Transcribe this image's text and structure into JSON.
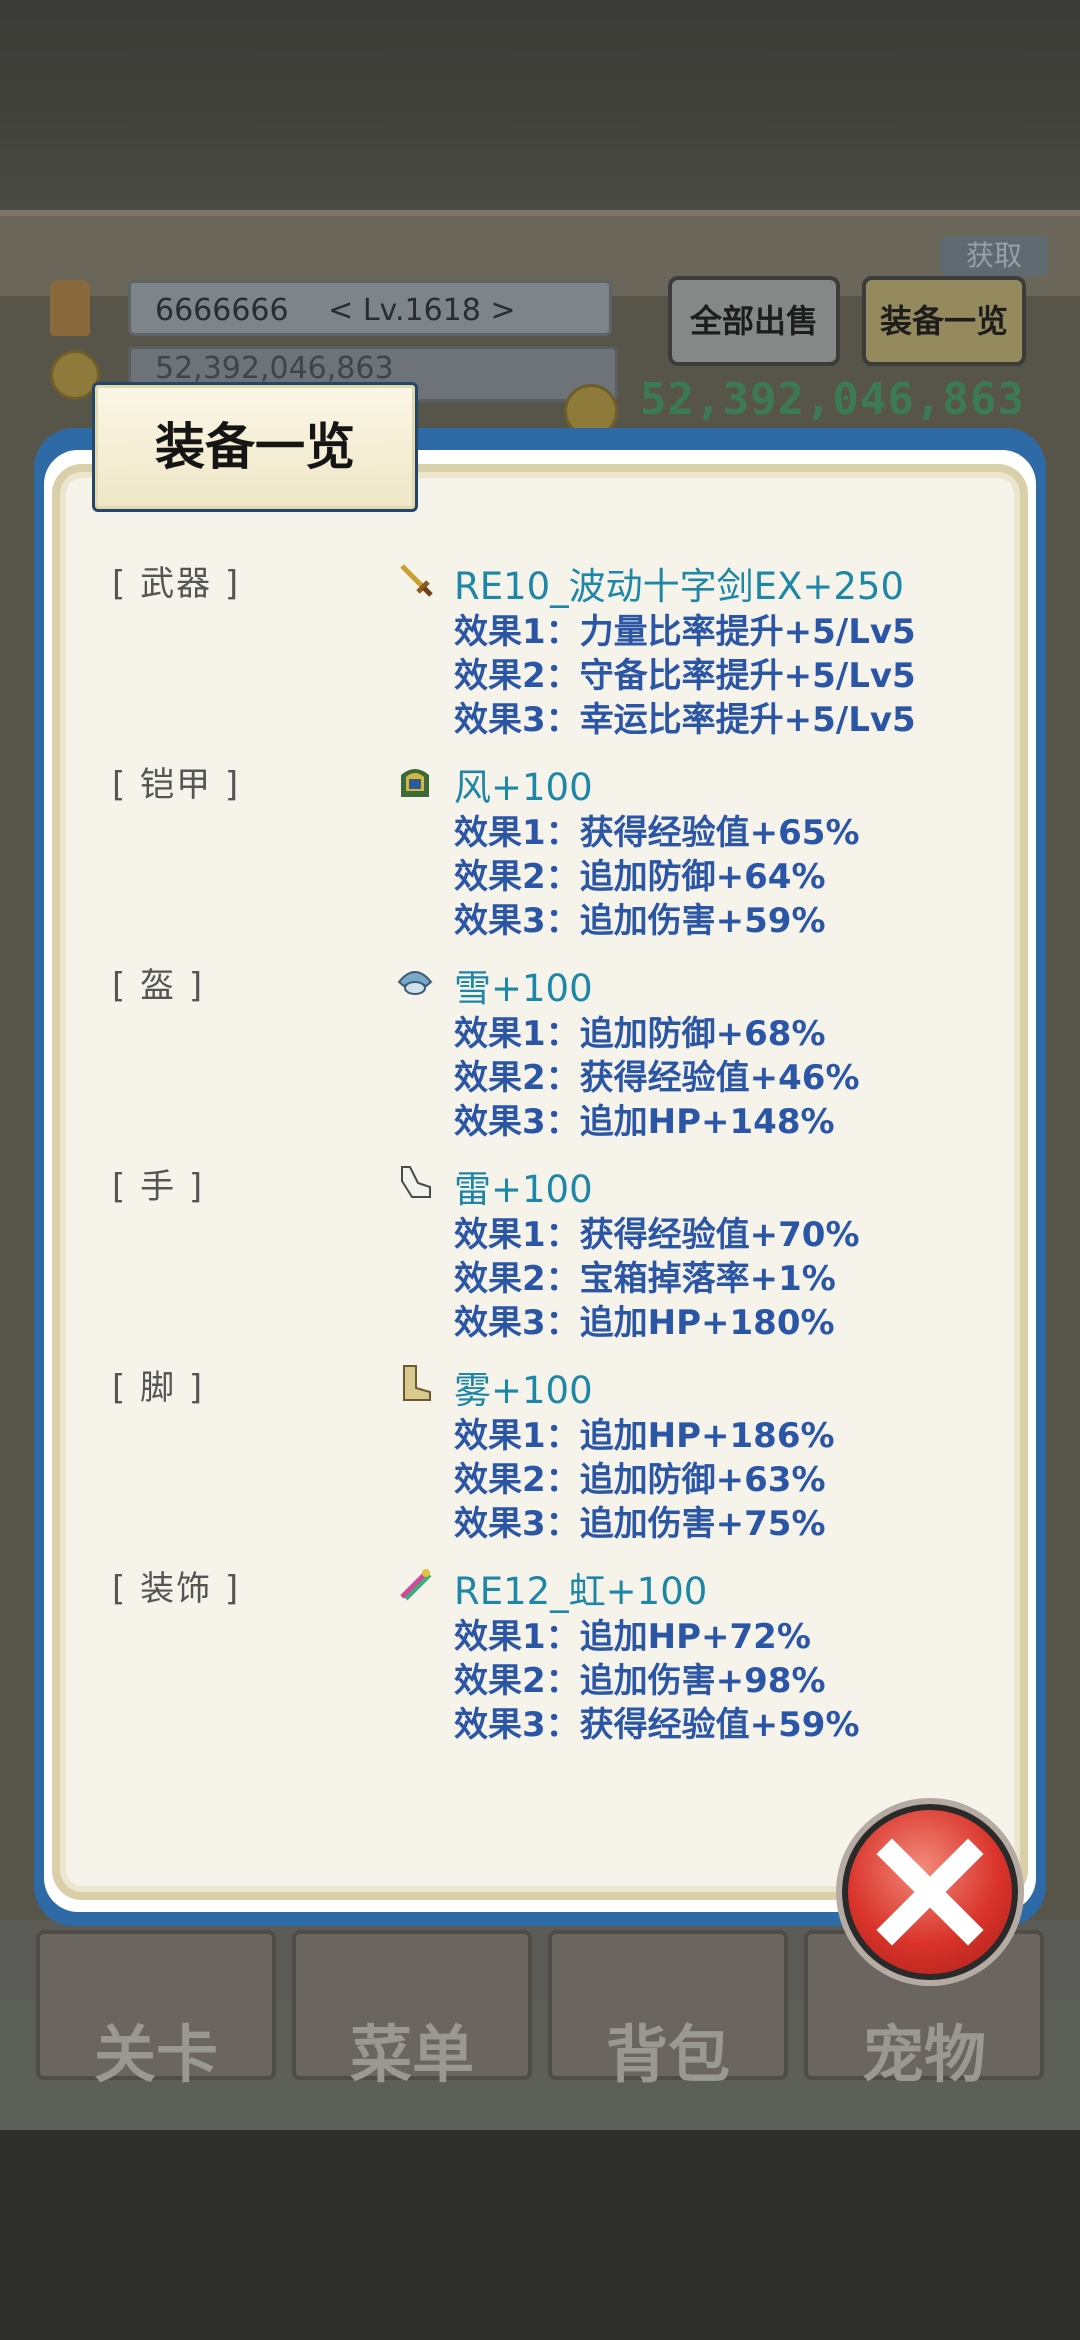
{
  "header": {
    "player_name": "6666666",
    "player_level": "< Lv.1618 >",
    "gold_amount_hidden": "52,392,046,863",
    "gold_amount": "52,392,046,863",
    "get_label": "获取",
    "sell_all_label": "全部出售",
    "equip_list_label": "装备一览"
  },
  "modal": {
    "title": "装备一览",
    "equipment": [
      {
        "slot": "[ 武器 ]",
        "icon": "sword-icon",
        "name": "RE10_波动十字剑EX+250",
        "effects": [
          "效果1：力量比率提升+5/Lv5",
          "效果2：守备比率提升+5/Lv5",
          "效果3：幸运比率提升+5/Lv5"
        ]
      },
      {
        "slot": "[ 铠甲 ]",
        "icon": "armor-icon",
        "name": "风+100",
        "effects": [
          "效果1：获得经验值+65%",
          "效果2：追加防御+64%",
          "效果3：追加伤害+59%"
        ]
      },
      {
        "slot": "[ 盔 ]",
        "icon": "helmet-icon",
        "name": "雪+100",
        "effects": [
          "效果1：追加防御+68%",
          "效果2：获得经验值+46%",
          "效果3：追加HP+148%"
        ]
      },
      {
        "slot": "[ 手 ]",
        "icon": "glove-icon",
        "name": "雷+100",
        "effects": [
          "效果1：获得经验值+70%",
          "效果2：宝箱掉落率+1%",
          "效果3：追加HP+180%"
        ]
      },
      {
        "slot": "[ 脚 ]",
        "icon": "boot-icon",
        "name": "雾+100",
        "effects": [
          "效果1：追加HP+186%",
          "效果2：追加防御+63%",
          "效果3：追加伤害+75%"
        ]
      },
      {
        "slot": "[ 装饰 ]",
        "icon": "accessory-icon",
        "name": "RE12_虹+100",
        "effects": [
          "效果1：追加HP+72%",
          "效果2：追加伤害+98%",
          "效果3：获得经验值+59%"
        ]
      }
    ]
  },
  "bottom_tabs": [
    "关卡",
    "菜单",
    "背包",
    "宠物"
  ],
  "colors": {
    "item_name": "#1e86a6",
    "effect_text": "#2b56a6",
    "modal_frame": "#2e6aa6",
    "close_button": "#d9332a"
  }
}
